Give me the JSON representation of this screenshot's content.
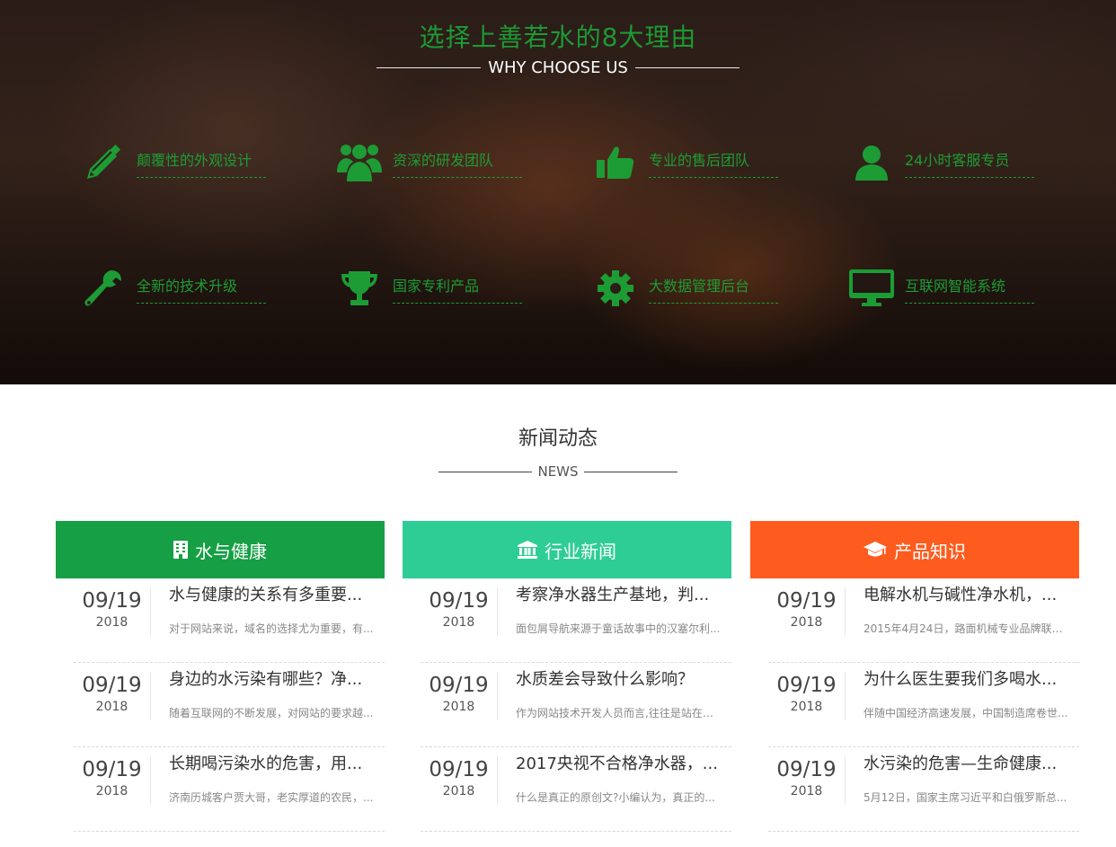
{
  "why": {
    "title": "选择上善若水的8大理由",
    "subtitle": "WHY CHOOSE US",
    "accent": "#1c9a34",
    "features": [
      {
        "label": "颠覆性的外观设计",
        "icon": "pencil-icon"
      },
      {
        "label": "资深的研发团队",
        "icon": "users-icon"
      },
      {
        "label": "专业的售后团队",
        "icon": "thumbs-up-icon"
      },
      {
        "label": "24小时客服专员",
        "icon": "user-icon"
      },
      {
        "label": "全新的技术升级",
        "icon": "wrench-icon"
      },
      {
        "label": "国家专利产品",
        "icon": "trophy-icon"
      },
      {
        "label": "大数据管理后台",
        "icon": "gear-icon"
      },
      {
        "label": "互联网智能系统",
        "icon": "monitor-icon"
      }
    ]
  },
  "news": {
    "title": "新闻动态",
    "subtitle": "NEWS",
    "columns": [
      {
        "title": "水与健康",
        "icon": "building-icon",
        "color": "#169f44",
        "items": [
          {
            "date": "09/19",
            "year": "2018",
            "title": "水与健康的关系有多重要...",
            "desc": "对于网站来说，域名的选择尤为重要，有..."
          },
          {
            "date": "09/19",
            "year": "2018",
            "title": "身边的水污染有哪些？净...",
            "desc": "随着互联网的不断发展，对网站的要求越..."
          },
          {
            "date": "09/19",
            "year": "2018",
            "title": "长期喝污染水的危害，用...",
            "desc": "济南历城客户贾大哥，老实厚道的农民，..."
          }
        ]
      },
      {
        "title": "行业新闻",
        "icon": "bank-icon",
        "color": "#2ecd96",
        "items": [
          {
            "date": "09/19",
            "year": "2018",
            "title": "考察净水器生产基地，判...",
            "desc": "面包屑导航来源于童话故事中的汉塞尔利..."
          },
          {
            "date": "09/19",
            "year": "2018",
            "title": "水质差会导致什么影响？",
            "desc": "作为网站技术开发人员而言,往往是站在自..."
          },
          {
            "date": "09/19",
            "year": "2018",
            "title": "2017央视不合格净水器，...",
            "desc": "什么是真正的原创文?小编认为，真正的..."
          }
        ]
      },
      {
        "title": "产品知识",
        "icon": "graduation-cap-icon",
        "color": "#fe5c1f",
        "items": [
          {
            "date": "09/19",
            "year": "2018",
            "title": "电解水机与碱性净水机，...",
            "desc": "2015年4月24日，路面机械专业品牌联盟..."
          },
          {
            "date": "09/19",
            "year": "2018",
            "title": "为什么医生要我们多喝水...",
            "desc": "伴随中国经济高速发展，中国制造席卷世..."
          },
          {
            "date": "09/19",
            "year": "2018",
            "title": "水污染的危害—生命健康...",
            "desc": "5月12日，国家主席习近平和白俄罗斯总..."
          }
        ]
      }
    ]
  }
}
